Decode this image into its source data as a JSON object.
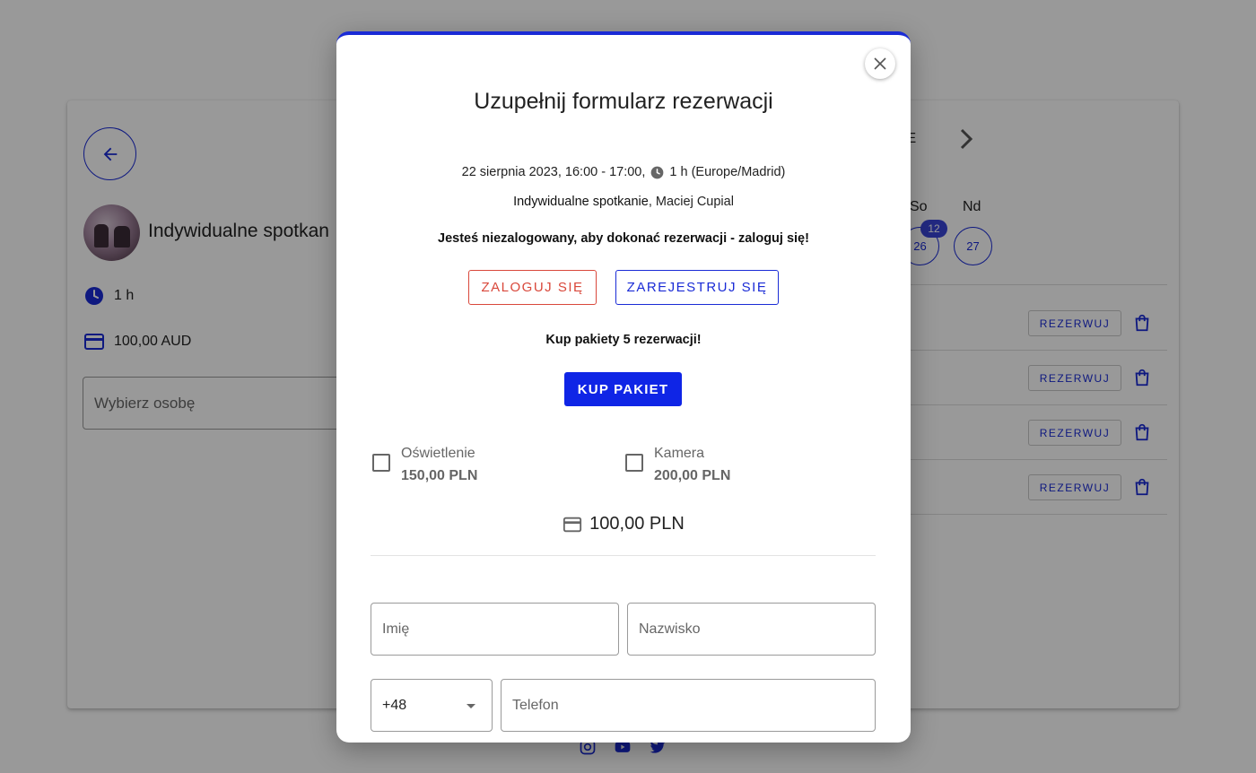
{
  "background": {
    "service_title": "Indywidualne spotkan",
    "duration": "1 h",
    "price": "100,00 AUD",
    "person_select_placeholder": "Wybierz osobę",
    "week_text_fragment": "IE",
    "days": [
      {
        "label": "So",
        "date": "26",
        "badge": "12"
      },
      {
        "label": "Nd",
        "date": "27"
      }
    ],
    "slot_button_label": "REZERWUJ",
    "slot_count": 4
  },
  "modal": {
    "title": "Uzupełnij formularz rezerwacji",
    "datetime": "22 sierpnia 2023, 16:00 - 17:00,",
    "duration_tz": "1 h (Europe/Madrid)",
    "service_name": "Indywidualne spotkanie",
    "service_person": ", Maciej Cupial",
    "login_notice": "Jesteś niezalogowany, aby dokonać rezerwacji - zaloguj się!",
    "login_button": "ZALOGUJ SIĘ",
    "register_button": "ZAREJESTRUJ SIĘ",
    "package_text": "Kup pakiety 5 rezerwacji!",
    "package_button": "KUP PAKIET",
    "addons": [
      {
        "name": "Oświetlenie",
        "price": "150,00 PLN",
        "checked": false
      },
      {
        "name": "Kamera",
        "price": "200,00 PLN",
        "checked": false
      }
    ],
    "total": "100,00 PLN",
    "form": {
      "first_name_placeholder": "Imię",
      "last_name_placeholder": "Nazwisko",
      "country_code": "+48",
      "phone_placeholder": "Telefon"
    }
  },
  "colors": {
    "primary": "#1a2bd6",
    "primary_fill": "#0f25e6",
    "danger": "#d9483b"
  }
}
